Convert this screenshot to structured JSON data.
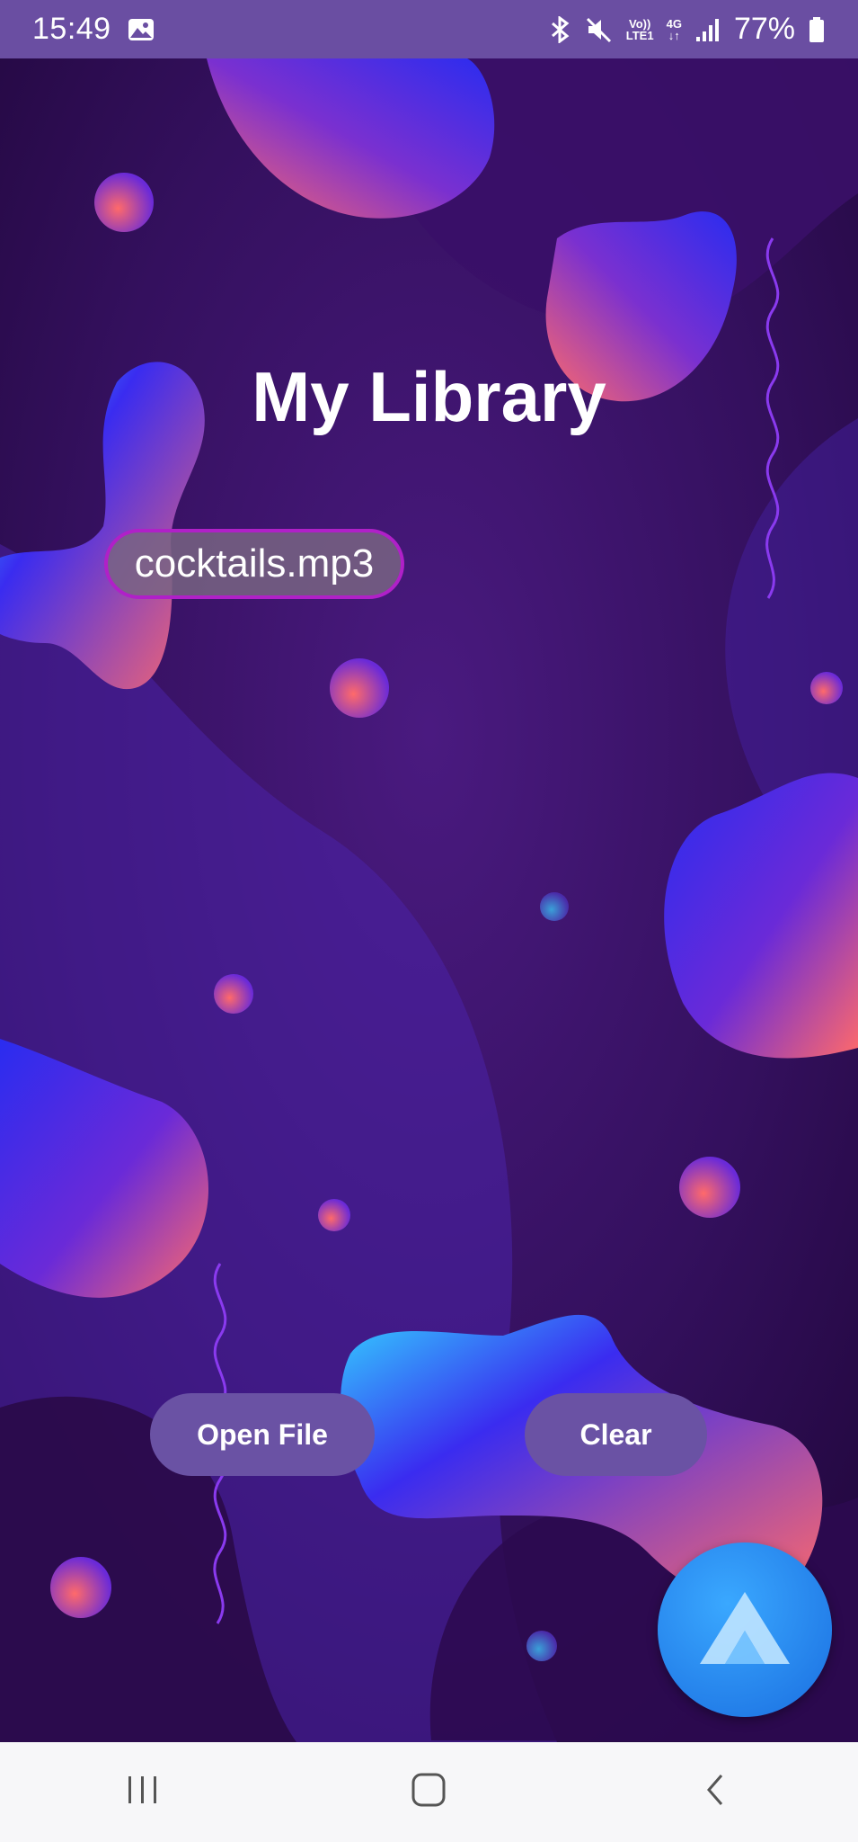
{
  "status_bar": {
    "time": "15:49",
    "volte_line1": "Vo))",
    "volte_line2": "LTE1",
    "network": "4G",
    "battery": "77%",
    "icons": [
      "gallery-icon",
      "bluetooth-icon",
      "mute-icon",
      "volte-icon",
      "4g-icon",
      "signal-icon",
      "battery-icon"
    ]
  },
  "page": {
    "title": "My Library",
    "selected_file": "cocktails.mp3"
  },
  "buttons": {
    "open_file": "Open File",
    "clear": "Clear"
  },
  "fab": {
    "icon": "app-logo-icon"
  },
  "nav_bar": {
    "icons": [
      "recent-apps-icon",
      "home-icon",
      "back-icon"
    ]
  },
  "colors": {
    "status_bar_bg": "#6a4ea2",
    "background": "#2a0a48",
    "button_bg": "#6a52a4",
    "chip_border": "#b020c8",
    "fab": "#1a6ee0"
  }
}
